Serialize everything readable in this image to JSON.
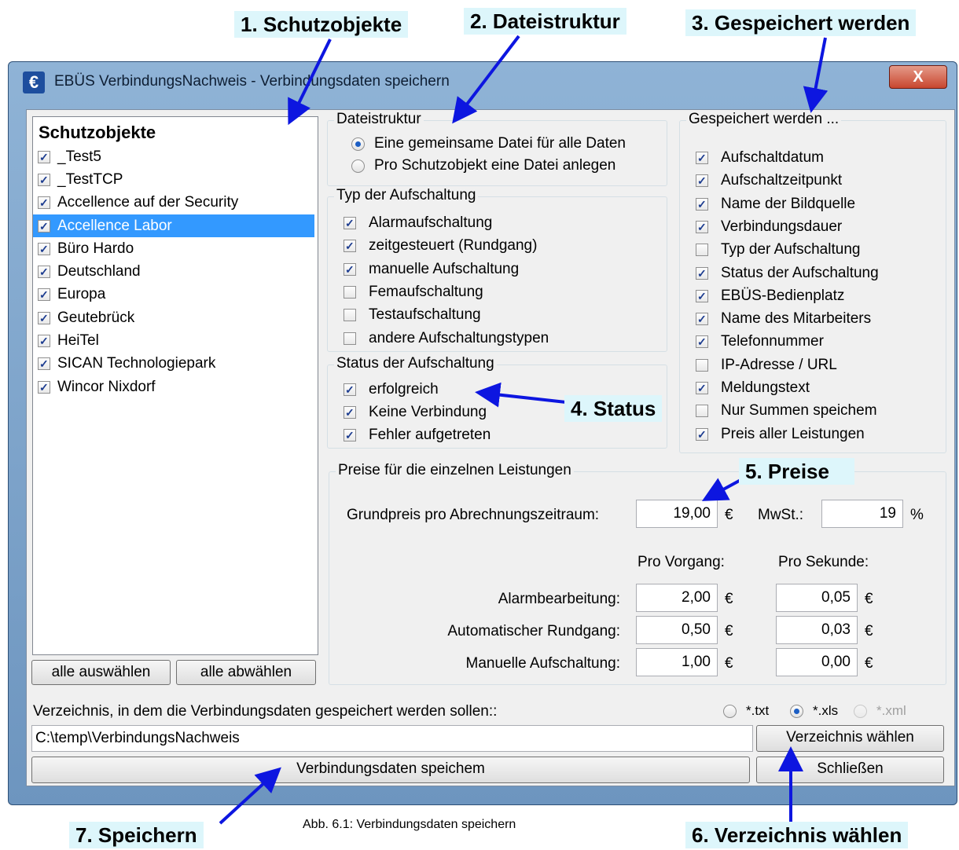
{
  "callouts": {
    "c1": "1. Schutzobjekte",
    "c2": "2. Dateistruktur",
    "c3": "3. Gespeichert werden",
    "c4": "4. Status",
    "c5": "5. Preise",
    "c6": "6. Verzeichnis wählen",
    "c7": "7. Speichern"
  },
  "window": {
    "title": "EBÜS VerbindungsNachweis - Verbindungsdaten speichern",
    "close_label": "X"
  },
  "schutzobjekte": {
    "header": "Schutzobjekte",
    "items": [
      {
        "label": "_Test5",
        "checked": true
      },
      {
        "label": "_TestTCP",
        "checked": true
      },
      {
        "label": "Accellence auf der Security",
        "checked": true
      },
      {
        "label": "Accellence Labor",
        "checked": true,
        "selected": true
      },
      {
        "label": "Büro Hardo",
        "checked": true
      },
      {
        "label": "Deutschland",
        "checked": true
      },
      {
        "label": "Europa",
        "checked": true
      },
      {
        "label": "Geutebrück",
        "checked": true
      },
      {
        "label": "HeiTel",
        "checked": true
      },
      {
        "label": "SICAN Technologiepark",
        "checked": true
      },
      {
        "label": "Wincor Nixdorf",
        "checked": true
      }
    ],
    "select_all": "alle auswählen",
    "deselect_all": "alle abwählen"
  },
  "dateistruktur": {
    "title": "Dateistruktur",
    "opt1": "Eine gemeinsame Datei für alle Daten",
    "opt2": "Pro Schutzobjekt eine Datei anlegen"
  },
  "typ": {
    "title": "Typ der Aufschaltung",
    "items": [
      "Alarmaufschaltung",
      "zeitgesteuert (Rundgang)",
      "manuelle Aufschaltung",
      "Femaufschaltung",
      "Testaufschaltung",
      "andere Aufschaltungstypen"
    ]
  },
  "status": {
    "title": "Status der Aufschaltung",
    "items": [
      "erfolgreich",
      "Keine Verbindung",
      "Fehler aufgetreten"
    ]
  },
  "gespeichert": {
    "title": "Gespeichert werden ...",
    "items": [
      "Aufschaltdatum",
      "Aufschaltzeitpunkt",
      "Name der Bildquelle",
      "Verbindungsdauer",
      "Typ der Aufschaltung",
      "Status der Aufschaltung",
      "EBÜS-Bedienplatz",
      "Name des Mitarbeiters",
      "Telefonnummer",
      "IP-Adresse / URL",
      "Meldungstext",
      "Nur Summen speichem",
      "Preis aller Leistungen"
    ]
  },
  "preise": {
    "title": "Preise für die einzelnen Leistungen",
    "grundpreis_label": "Grundpreis pro Abrechnungszeitraum:",
    "grundpreis_value": "19,00",
    "currency": "€",
    "mwst_label": "MwSt.:",
    "mwst_value": "19",
    "percent": "%",
    "col1": "Pro Vorgang:",
    "col2": "Pro Sekunde:",
    "rows": [
      {
        "label": "Alarmbearbeitung:",
        "vorgang": "2,00",
        "sekunde": "0,05"
      },
      {
        "label": "Automatischer Rundgang:",
        "vorgang": "0,50",
        "sekunde": "0,03"
      },
      {
        "label": "Manuelle Aufschaltung:",
        "vorgang": "1,00",
        "sekunde": "0,00"
      }
    ]
  },
  "directory": {
    "label": "Verzeichnis, in dem die Verbindungsdaten gespeichert werden sollen::",
    "path": "C:\\temp\\VerbindungsNachweis",
    "fmt_txt": "*.txt",
    "fmt_xls": "*.xls",
    "fmt_xml": "*.xml",
    "choose_btn": "Verzeichnis wählen",
    "save_btn": "Verbindungsdaten speichem",
    "close_btn": "Schließen"
  },
  "caption": "Abb. 6.1: Verbindungsdaten speichern"
}
